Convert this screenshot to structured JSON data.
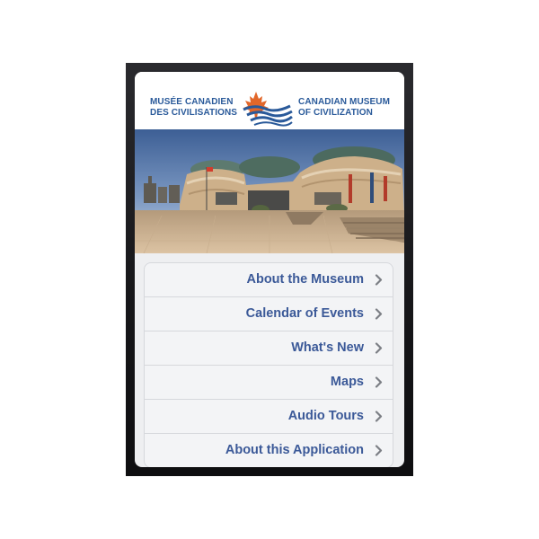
{
  "header": {
    "logo_fr_line1": "MUSÉE CANADIEN",
    "logo_fr_line2": "DES CIVILISATIONS",
    "logo_en_line1": "CANADIAN MUSEUM",
    "logo_en_line2": "OF CIVILIZATION"
  },
  "menu": {
    "items": [
      {
        "label": "About the Museum"
      },
      {
        "label": "Calendar of Events"
      },
      {
        "label": "What's New"
      },
      {
        "label": "Maps"
      },
      {
        "label": "Audio Tours"
      },
      {
        "label": "About this Application"
      }
    ]
  },
  "colors": {
    "link_text": "#3b5998",
    "logo_blue": "#2a5a9a",
    "maple_leaf": "#e2672a"
  }
}
